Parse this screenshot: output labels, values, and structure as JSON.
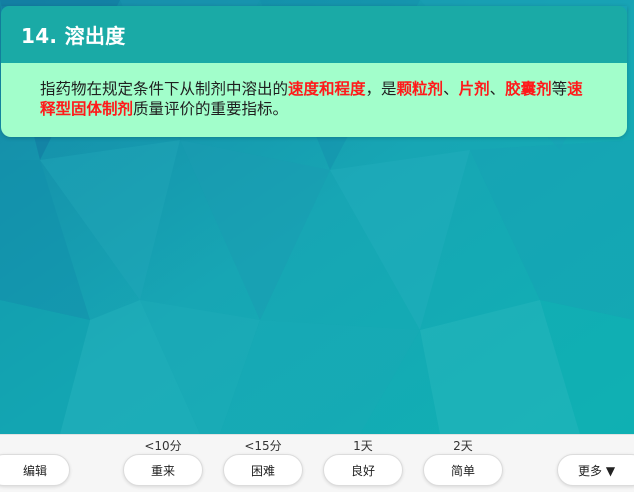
{
  "card": {
    "title": "14. 溶出度",
    "body": [
      {
        "text": "指药物在规定条件下从制剂中溶出的",
        "hl": false
      },
      {
        "text": "速度和程度",
        "hl": true
      },
      {
        "text": "，是",
        "hl": false
      },
      {
        "text": "颗粒剂",
        "hl": true
      },
      {
        "text": "、",
        "hl": false
      },
      {
        "text": "片剂",
        "hl": true
      },
      {
        "text": "、",
        "hl": false
      },
      {
        "text": "胶囊剂",
        "hl": true
      },
      {
        "text": "等",
        "hl": false
      },
      {
        "text": "速释型固体制剂",
        "hl": true
      },
      {
        "text": "质量评价的重要指标。",
        "hl": false
      }
    ]
  },
  "colors": {
    "header": "#1aaaa6",
    "body_bg": "#a2fecb",
    "highlight": "#ff1a1a",
    "background": "#17a7b3"
  },
  "bottom_bar": {
    "edit": "编辑",
    "again": {
      "time": "<10分",
      "label": "重来"
    },
    "hard": {
      "time": "<15分",
      "label": "困难"
    },
    "good": {
      "time": "1天",
      "label": "良好"
    },
    "easy": {
      "time": "2天",
      "label": "简单"
    },
    "more": "更多 ▼"
  }
}
